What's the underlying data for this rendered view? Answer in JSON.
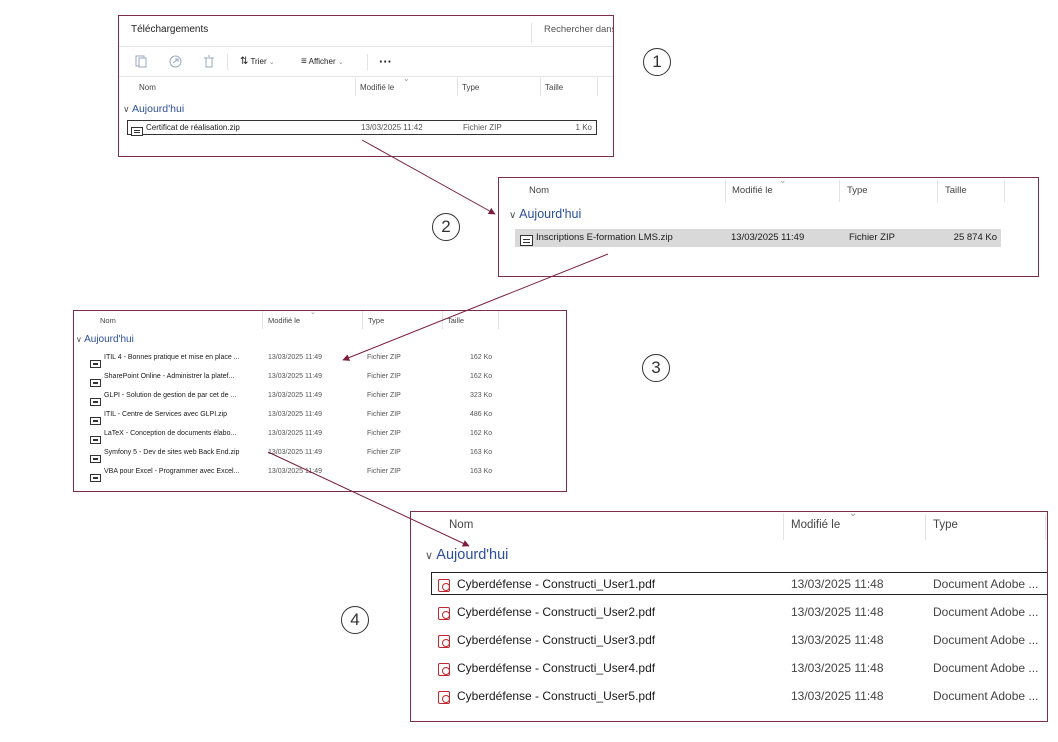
{
  "colors": {
    "frame": "#7b2d4a",
    "arrow": "#7b1f3f",
    "group": "#2b4f9c",
    "pdf": "#c4262e"
  },
  "steps": [
    "1",
    "2",
    "3",
    "4"
  ],
  "panel1": {
    "title": "Téléchargements",
    "search_placeholder": "Rechercher dans",
    "toolbar": {
      "sort_label": "Trier",
      "view_label": "Afficher",
      "more_label": "···",
      "icons": [
        "copy-icon",
        "share-icon",
        "delete-icon",
        "sort-icon",
        "view-icon"
      ]
    },
    "columns": {
      "name": "Nom",
      "modified": "Modifié le",
      "type": "Type",
      "size": "Taille"
    },
    "group": "Aujourd'hui",
    "rows": [
      {
        "name": "Certificat de réalisation.zip",
        "modified": "13/03/2025 11:42",
        "type": "Fichier ZIP",
        "size": "1 Ko"
      }
    ]
  },
  "panel2": {
    "columns": {
      "name": "Nom",
      "modified": "Modifié le",
      "type": "Type",
      "size": "Taille"
    },
    "group": "Aujourd'hui",
    "rows": [
      {
        "name": "Inscriptions E-formation LMS.zip",
        "modified": "13/03/2025 11:49",
        "type": "Fichier ZIP",
        "size": "25 874 Ko"
      }
    ]
  },
  "panel3": {
    "columns": {
      "name": "Nom",
      "modified": "Modifié le",
      "type": "Type",
      "size": "Taille"
    },
    "group": "Aujourd'hui",
    "rows": [
      {
        "name": "ITIL 4 - Bonnes pratique et mise en place ...",
        "modified": "13/03/2025 11:49",
        "type": "Fichier ZIP",
        "size": "162 Ko"
      },
      {
        "name": "SharePoint Online - Administrer la platef...",
        "modified": "13/03/2025 11:49",
        "type": "Fichier ZIP",
        "size": "162 Ko"
      },
      {
        "name": "GLPI - Solution de gestion de par cet de ...",
        "modified": "13/03/2025 11:49",
        "type": "Fichier ZIP",
        "size": "323 Ko"
      },
      {
        "name": "ITIL - Centre de Services avec GLPI.zip",
        "modified": "13/03/2025 11:49",
        "type": "Fichier ZIP",
        "size": "486 Ko"
      },
      {
        "name": "LaTeX - Conception de documents élabo...",
        "modified": "13/03/2025 11:49",
        "type": "Fichier ZIP",
        "size": "162 Ko"
      },
      {
        "name": "Symfony 5 - Dev de sites web Back End.zip",
        "modified": "13/03/2025 11:49",
        "type": "Fichier ZIP",
        "size": "163 Ko"
      },
      {
        "name": "VBA pour Excel - Programmer avec Excel...",
        "modified": "13/03/2025 11:49",
        "type": "Fichier ZIP",
        "size": "163 Ko"
      }
    ]
  },
  "panel4": {
    "columns": {
      "name": "Nom",
      "modified": "Modifié le",
      "type": "Type"
    },
    "group": "Aujourd'hui",
    "rows": [
      {
        "name": "Cyberdéfense - Constructi_User1.pdf",
        "modified": "13/03/2025 11:48",
        "type": "Document Adobe ..."
      },
      {
        "name": "Cyberdéfense - Constructi_User2.pdf",
        "modified": "13/03/2025 11:48",
        "type": "Document Adobe ..."
      },
      {
        "name": "Cyberdéfense - Constructi_User3.pdf",
        "modified": "13/03/2025 11:48",
        "type": "Document Adobe ..."
      },
      {
        "name": "Cyberdéfense - Constructi_User4.pdf",
        "modified": "13/03/2025 11:48",
        "type": "Document Adobe ..."
      },
      {
        "name": "Cyberdéfense - Constructi_User5.pdf",
        "modified": "13/03/2025 11:48",
        "type": "Document Adobe ..."
      }
    ]
  }
}
